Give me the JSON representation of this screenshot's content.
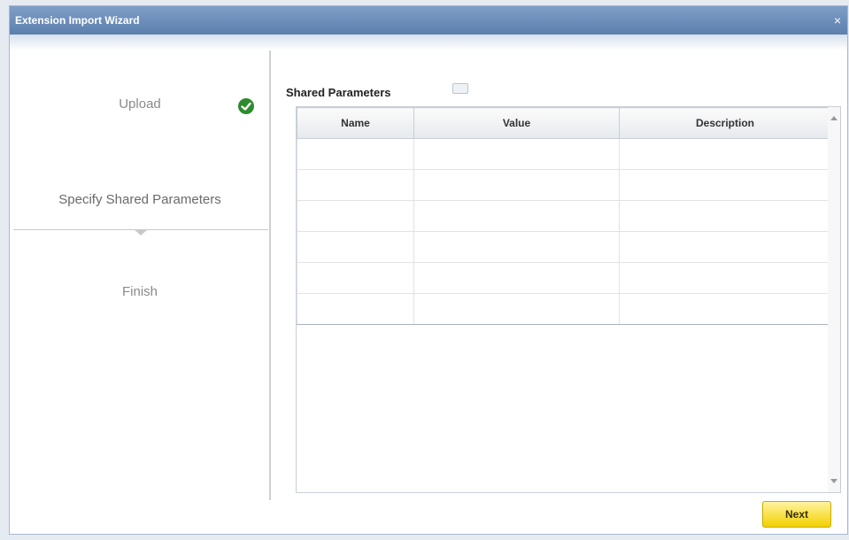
{
  "window": {
    "title": "Extension Import Wizard",
    "close_symbol": "×"
  },
  "steps": [
    {
      "label": "Upload",
      "status": "complete",
      "icon": "checkmark-icon"
    },
    {
      "label": "Specify Shared Parameters",
      "status": "current"
    },
    {
      "label": "Finish",
      "status": "pending"
    }
  ],
  "section": {
    "title": "Shared Parameters",
    "help_icon": "help-icon"
  },
  "table": {
    "columns": [
      "Name",
      "Value",
      "Description"
    ],
    "rows": [
      [
        "",
        "",
        ""
      ],
      [
        "",
        "",
        ""
      ],
      [
        "",
        "",
        ""
      ],
      [
        "",
        "",
        ""
      ],
      [
        "",
        "",
        ""
      ],
      [
        "",
        "",
        ""
      ]
    ]
  },
  "footer": {
    "next_label": "Next"
  },
  "colors": {
    "titlebar": "#5c7fad",
    "check": "#2e8b2e",
    "next_button": "#f2d100"
  }
}
